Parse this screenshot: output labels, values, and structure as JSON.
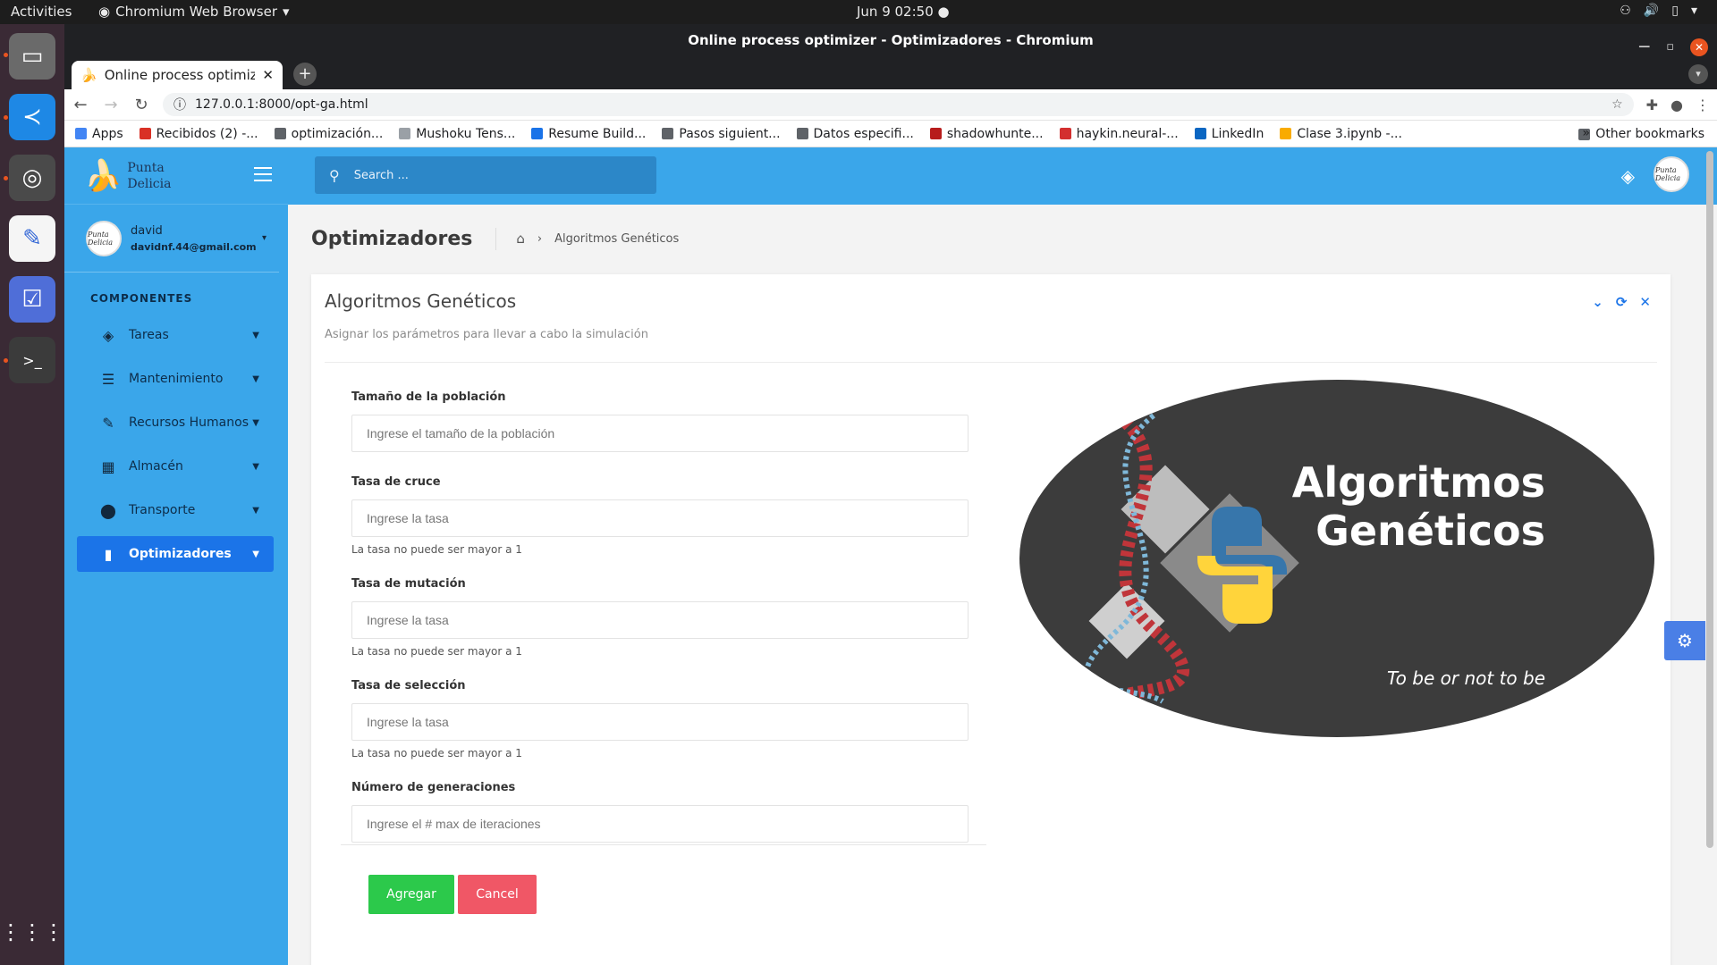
{
  "os": {
    "activities": "Activities",
    "app_menu": "Chromium Web Browser",
    "clock": "Jun 9  02:50"
  },
  "browser": {
    "window_title": "Online process optimizer - Optimizadores - Chromium",
    "tab_title": "Online process optimizer",
    "url": "127.0.0.1:8000/opt-ga.html",
    "bookmarks": [
      {
        "label": "Apps",
        "color": "#4285f4"
      },
      {
        "label": "Recibidos (2) -...",
        "color": "#d93025"
      },
      {
        "label": "optimización...",
        "color": "#5f6368"
      },
      {
        "label": "Mushoku Tens...",
        "color": "#9aa0a6"
      },
      {
        "label": "Resume Build...",
        "color": "#1a73e8"
      },
      {
        "label": "Pasos siguient...",
        "color": "#5f6368"
      },
      {
        "label": "Datos especifi...",
        "color": "#5f6368"
      },
      {
        "label": "shadowhunte...",
        "color": "#b71c1c"
      },
      {
        "label": "haykin.neural-...",
        "color": "#d32f2f"
      },
      {
        "label": "LinkedIn",
        "color": "#0a66c2"
      },
      {
        "label": "Clase 3.ipynb -...",
        "color": "#f9ab00"
      }
    ],
    "other_bookmarks": "Other bookmarks"
  },
  "sidebar": {
    "brand": "Punta Delicia",
    "brand_line1": "Punta",
    "brand_line2": "Delicia",
    "avatar_text": "Punta Delicia",
    "user_name": "david",
    "user_email": "davidnf.44@gmail.com",
    "section": "COMPONENTES",
    "items": [
      {
        "label": "Tareas",
        "icon": "layers-icon"
      },
      {
        "label": "Mantenimiento",
        "icon": "list-icon"
      },
      {
        "label": "Recursos Humanos",
        "icon": "edit-icon"
      },
      {
        "label": "Almacén",
        "icon": "table-icon"
      },
      {
        "label": "Transporte",
        "icon": "map-pin-icon"
      },
      {
        "label": "Optimizadores",
        "icon": "bar-chart-icon",
        "active": true
      }
    ]
  },
  "header": {
    "search_placeholder": "Search ..."
  },
  "page": {
    "title": "Optimizadores",
    "breadcrumb_current": "Algoritmos Genéticos"
  },
  "card": {
    "title": "Algoritmos Genéticos",
    "subtitle": "Asignar los parámetros para llevar a cabo la simulación",
    "fields": [
      {
        "label": "Tamaño de la población",
        "placeholder": "Ingrese el tamaño de la población",
        "help": ""
      },
      {
        "label": "Tasa de cruce",
        "placeholder": "Ingrese la tasa",
        "help": "La tasa no puede ser mayor a 1"
      },
      {
        "label": "Tasa de mutación",
        "placeholder": "Ingrese la tasa",
        "help": "La tasa no puede ser mayor a 1"
      },
      {
        "label": "Tasa de selección",
        "placeholder": "Ingrese la tasa",
        "help": "La tasa no puede ser mayor a 1"
      },
      {
        "label": "Número de generaciones",
        "placeholder": "Ingrese el # max de iteraciones",
        "help": ""
      }
    ],
    "add_button": "Agregar",
    "cancel_button": "Cancel",
    "hero_title_1": "Algoritmos",
    "hero_title_2": "Genéticos",
    "hero_subtitle": "To be or not to be"
  },
  "colors": {
    "accent": "#3aa6ea",
    "active": "#1b74e8",
    "success": "#2cc94b",
    "danger": "#f05766"
  }
}
